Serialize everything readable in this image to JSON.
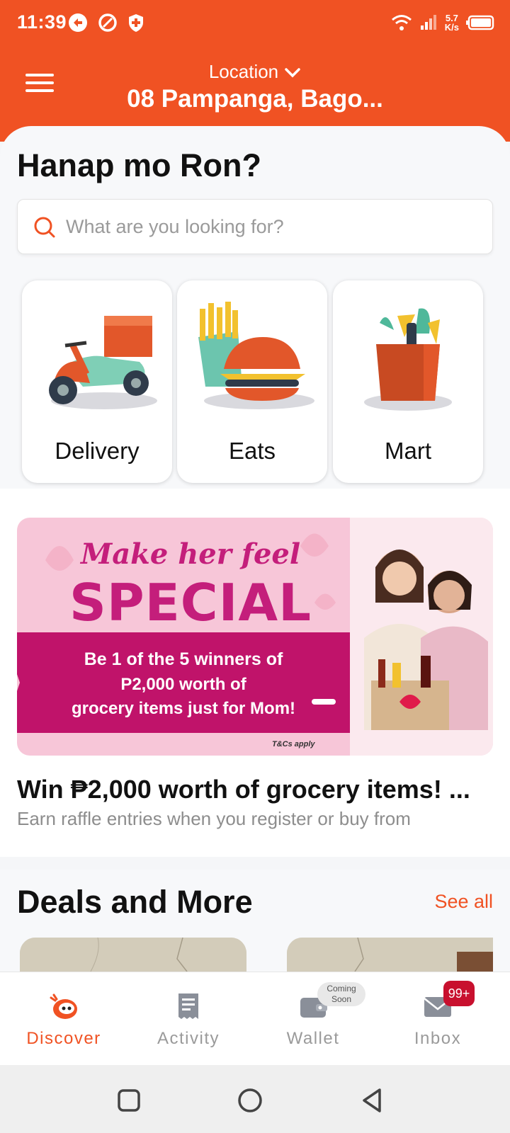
{
  "status_bar": {
    "time": "11:39",
    "speed_value": "5.7",
    "speed_unit": "K/s"
  },
  "header": {
    "location_label": "Location",
    "location_value": "08 Pampanga, Bago..."
  },
  "main": {
    "title": "Hanap mo Ron?",
    "search_placeholder": "What are you looking for?",
    "services": [
      {
        "label": "Delivery",
        "icon": "scooter-icon"
      },
      {
        "label": "Eats",
        "icon": "burger-fries-icon"
      },
      {
        "label": "Mart",
        "icon": "grocery-bag-icon"
      }
    ]
  },
  "banner": {
    "script_text": "Make her feel",
    "headline": "SPECIAL",
    "line1": "Be 1 of the 5 winners of",
    "line2": "P2,000 worth of",
    "line3": "grocery items just for Mom!",
    "terms": "T&Cs apply"
  },
  "promo": {
    "title": "Win ₱2,000 worth of grocery items! ...",
    "subtitle": "Earn raffle entries when you register or buy from PickaRoo Mart!"
  },
  "deals": {
    "title": "Deals and More",
    "see_all": "See all"
  },
  "bottom_nav": {
    "items": [
      {
        "label": "Discover",
        "icon": "discover-icon",
        "active": true
      },
      {
        "label": "Activity",
        "icon": "receipt-icon",
        "active": false
      },
      {
        "label": "Wallet",
        "icon": "wallet-icon",
        "active": false,
        "badge": "Coming Soon"
      },
      {
        "label": "Inbox",
        "icon": "mail-icon",
        "active": false,
        "badge": "99+"
      }
    ]
  },
  "colors": {
    "brand": "#f05223",
    "badge_red": "#c8102e",
    "banner_pink": "#c41e7b"
  }
}
